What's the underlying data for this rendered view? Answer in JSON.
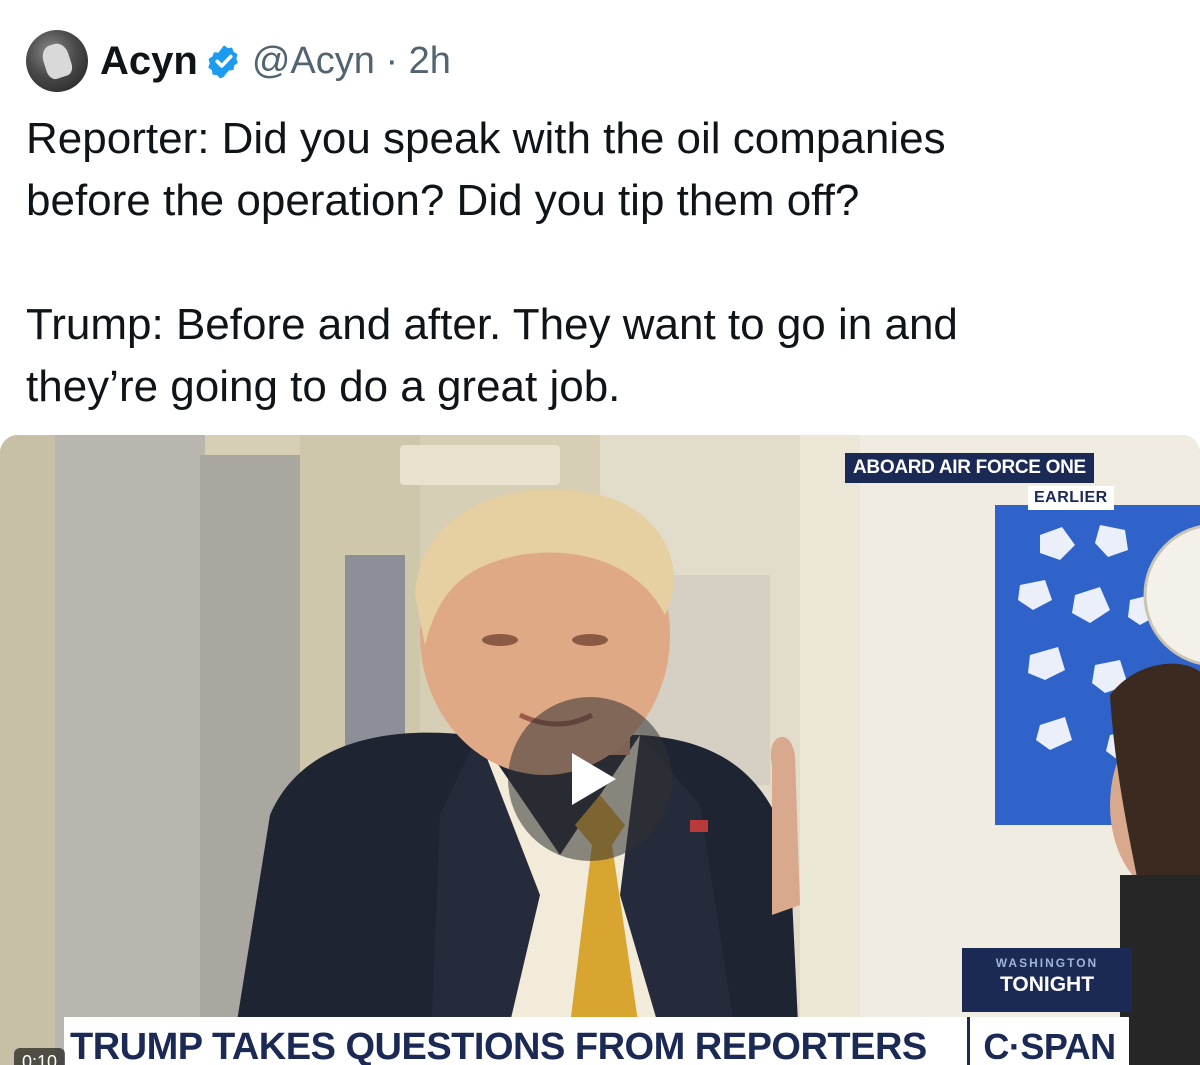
{
  "author": {
    "name": "Acyn",
    "handle": "@Acyn",
    "separator": "·",
    "time": "2h",
    "verified": true,
    "avatar_icon": "avatar-photo"
  },
  "tweet": {
    "reporter_line": "Reporter: Did you speak with the oil companies\nbefore the operation? Did you tip them off?",
    "trump_line": "Trump: Before and after. They want to go in and\nthey’re going to do a great job."
  },
  "video": {
    "location_badge": "ABOARD AIR FORCE ONE",
    "time_badge": "EARLIER",
    "show_name_small": "WASHINGTON",
    "show_name_big": "TONIGHT",
    "chyron": "TRUMP TAKES QUESTIONS FROM REPORTERS",
    "network": "C·SPAN",
    "duration": "0:10",
    "play_icon": "play-icon"
  },
  "colors": {
    "verified_blue": "#1d9bf0",
    "text_primary": "#0f1419",
    "text_secondary": "#536471",
    "cspan_navy": "#1b2a55",
    "tie_gold": "#d9a531"
  }
}
